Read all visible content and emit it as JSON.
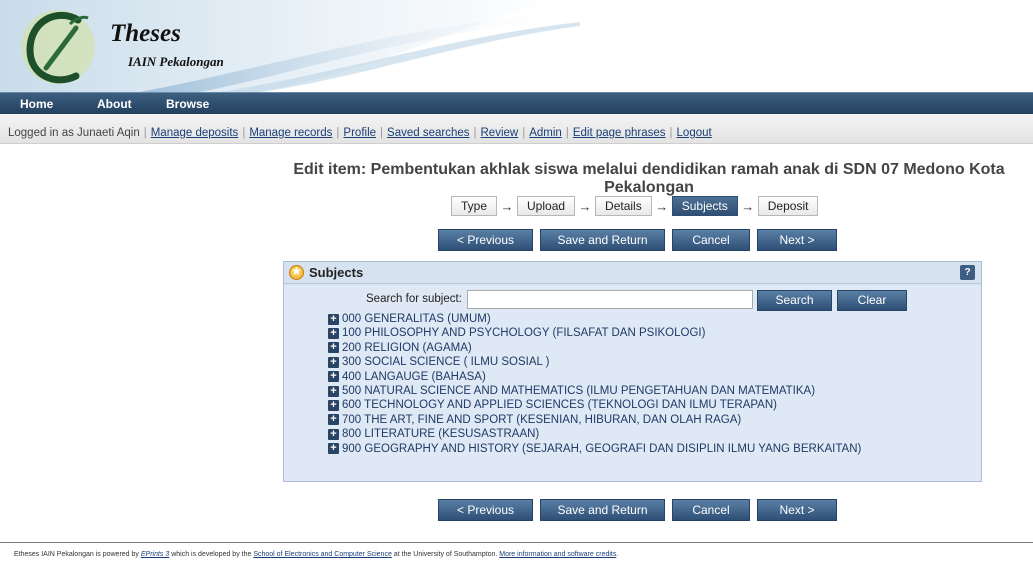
{
  "header": {
    "logo_title": "Theses",
    "logo_subtitle": "IAIN Pekalongan"
  },
  "mainnav": {
    "items": [
      "Home",
      "About",
      "Browse"
    ]
  },
  "userbar": {
    "logged_in": "Logged in as Junaeti Aqin",
    "links": [
      "Manage deposits",
      "Manage records",
      "Profile",
      "Saved searches",
      "Review",
      "Admin",
      "Edit page phrases",
      "Logout"
    ]
  },
  "page": {
    "title_line1": "Edit item: Pembentukan akhlak siswa melalui dendidikan ramah anak di SDN 07 Medono Kota",
    "title_line2": "Pekalongan"
  },
  "workflow": {
    "steps": [
      "Type",
      "Upload",
      "Details",
      "Subjects",
      "Deposit"
    ],
    "active": "Subjects",
    "arrow": "→"
  },
  "buttons": {
    "previous": "< Previous",
    "save_return": "Save and Return",
    "cancel": "Cancel",
    "next": "Next >"
  },
  "subjects_panel": {
    "title": "Subjects",
    "help": "?",
    "search_label": "Search for subject:",
    "search_value": "",
    "search_button": "Search",
    "clear_button": "Clear",
    "expand_glyph": "+",
    "items": [
      "000 GENERALITAS (UMUM)",
      "100 PHILOSOPHY AND PSYCHOLOGY (FILSAFAT DAN PSIKOLOGI)",
      "200 RELIGION (AGAMA)",
      "300 SOCIAL SCIENCE ( ILMU SOSIAL )",
      "400 LANGAUGE (BAHASA)",
      "500 NATURAL SCIENCE AND MATHEMATICS (ILMU PENGETAHUAN DAN MATEMATIKA)",
      "600 TECHNOLOGY AND APPLIED SCIENCES (TEKNOLOGI DAN ILMU TERAPAN)",
      "700 THE ART, FINE AND SPORT (KESENIAN, HIBURAN, DAN OLAH RAGA)",
      "800 LITERATURE (KESUSASTRAAN)",
      "900 GEOGRAPHY AND HISTORY (SEJARAH, GEOGRAFI DAN DISIPLIN ILMU YANG BERKAITAN)"
    ]
  },
  "footer": {
    "text1": "Etheses IAIN Pekalongan is powered by ",
    "link1": "EPrints 3",
    "text2": " which is developed by the ",
    "link2": "School of Electronics and Computer Science",
    "text3": " at the University of Southampton. ",
    "link3": "More information and software credits",
    "text4": "."
  },
  "colors": {
    "nav_bar": "#2f4f74",
    "button": "#3e628a",
    "panel_bg": "#dfe8f5",
    "link": "#1a3f78"
  }
}
